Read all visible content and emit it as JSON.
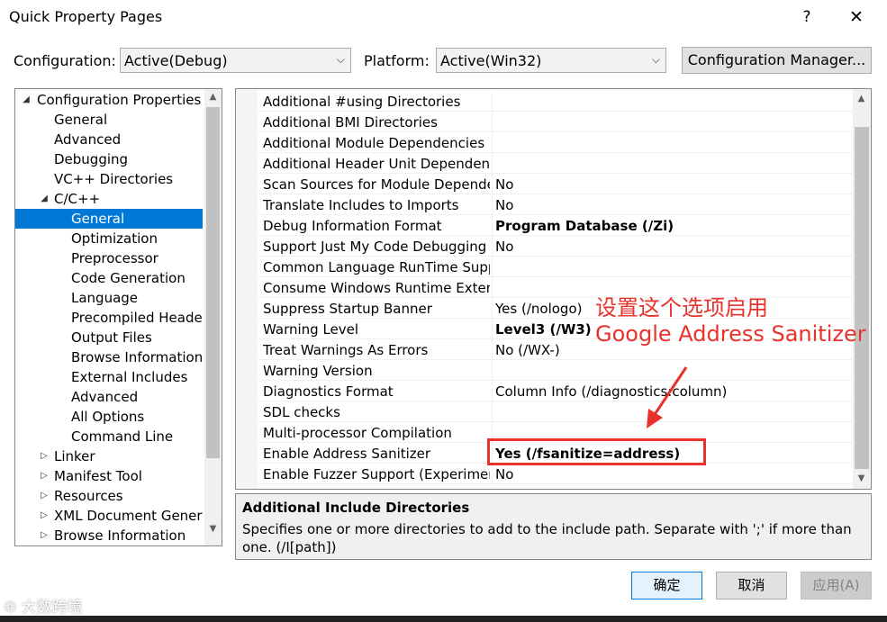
{
  "window": {
    "title": "Quick Property Pages",
    "help_label": "?",
    "close_label": "✕"
  },
  "config_bar": {
    "configuration_label": "Configuration:",
    "configuration_value": "Active(Debug)",
    "platform_label": "Platform:",
    "platform_value": "Active(Win32)",
    "config_manager_label": "Configuration Manager..."
  },
  "tree": {
    "items": [
      {
        "label": "Configuration Properties"
      },
      {
        "label": "General"
      },
      {
        "label": "Advanced"
      },
      {
        "label": "Debugging"
      },
      {
        "label": "VC++ Directories"
      },
      {
        "label": "C/C++"
      },
      {
        "label": "General"
      },
      {
        "label": "Optimization"
      },
      {
        "label": "Preprocessor"
      },
      {
        "label": "Code Generation"
      },
      {
        "label": "Language"
      },
      {
        "label": "Precompiled Headers"
      },
      {
        "label": "Output Files"
      },
      {
        "label": "Browse Information"
      },
      {
        "label": "External Includes"
      },
      {
        "label": "Advanced"
      },
      {
        "label": "All Options"
      },
      {
        "label": "Command Line"
      },
      {
        "label": "Linker"
      },
      {
        "label": "Manifest Tool"
      },
      {
        "label": "Resources"
      },
      {
        "label": "XML Document Generator"
      },
      {
        "label": "Browse Information"
      }
    ]
  },
  "properties": [
    {
      "name": "Additional #using Directories",
      "value": ""
    },
    {
      "name": "Additional BMI Directories",
      "value": ""
    },
    {
      "name": "Additional Module Dependencies",
      "value": ""
    },
    {
      "name": "Additional Header Unit Dependencies",
      "value": ""
    },
    {
      "name": "Scan Sources for Module Dependencies",
      "value": "No"
    },
    {
      "name": "Translate Includes to Imports",
      "value": "No"
    },
    {
      "name": "Debug Information Format",
      "value": "Program Database (/Zi)"
    },
    {
      "name": "Support Just My Code Debugging",
      "value": "No"
    },
    {
      "name": "Common Language RunTime Support",
      "value": ""
    },
    {
      "name": "Consume Windows Runtime Extension",
      "value": ""
    },
    {
      "name": "Suppress Startup Banner",
      "value": "Yes (/nologo)"
    },
    {
      "name": "Warning Level",
      "value": "Level3 (/W3)"
    },
    {
      "name": "Treat Warnings As Errors",
      "value": "No (/WX-)"
    },
    {
      "name": "Warning Version",
      "value": ""
    },
    {
      "name": "Diagnostics Format",
      "value": "Column Info (/diagnostics:column)"
    },
    {
      "name": "SDL checks",
      "value": ""
    },
    {
      "name": "Multi-processor Compilation",
      "value": ""
    },
    {
      "name": "Enable Address Sanitizer",
      "value": "Yes (/fsanitize=address)"
    },
    {
      "name": "Enable Fuzzer Support (Experimental)",
      "value": "No"
    }
  ],
  "description": {
    "title": "Additional Include Directories",
    "text": "Specifies one or more directories to add to the include path. Separate with ';' if more than one. (/I[path])"
  },
  "buttons": {
    "ok": "确定",
    "cancel": "取消",
    "apply": "应用(A)"
  },
  "annotation": {
    "line1": "设置这个选项启用",
    "line2": "Google Address Sanitizer",
    "color": "#e8322c"
  },
  "watermark": "大数跨境",
  "colors": {
    "selection": "#0078d7",
    "accent_red": "#e8322c"
  }
}
